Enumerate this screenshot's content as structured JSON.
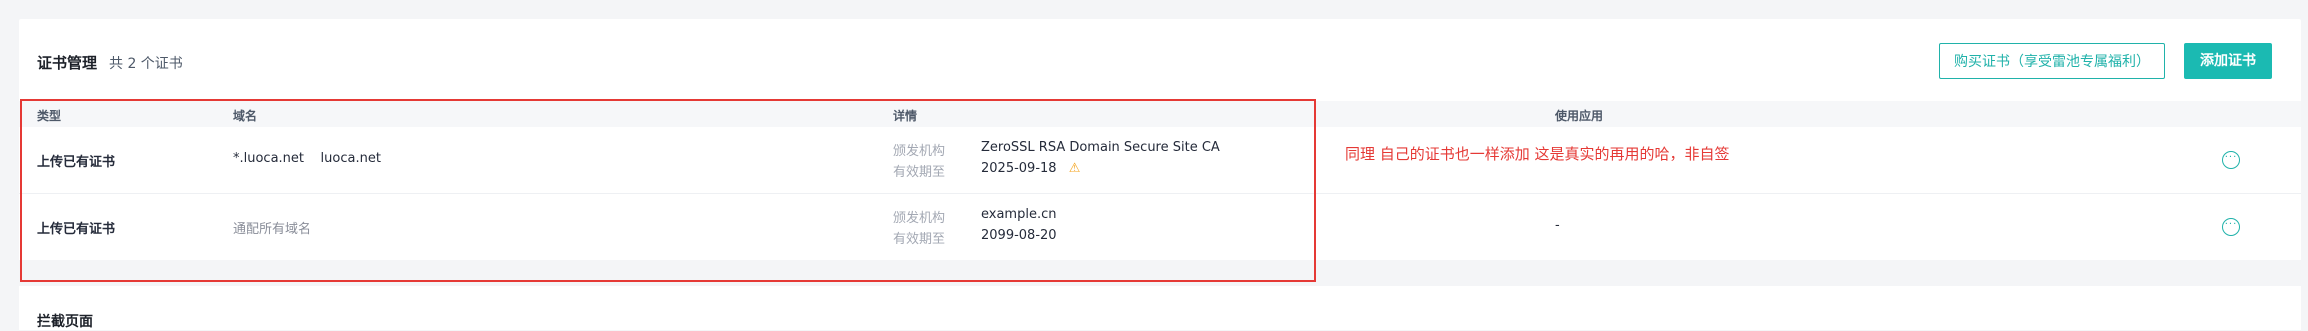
{
  "header": {
    "title": "证书管理",
    "count": "共 2 个证书",
    "buy_button": "购买证书（享受雷池专属福利）",
    "add_button": "添加证书"
  },
  "table": {
    "columns": [
      "类型",
      "域名",
      "详情",
      "使用应用"
    ],
    "rows": [
      {
        "type": "上传已有证书",
        "domains": "*.luoca.net    luoca.net",
        "issuer_label": "颁发机构",
        "issuer": "ZeroSSL RSA Domain Secure Site CA",
        "expiry_label": "有效期至",
        "expiry": "2025-09-18",
        "app": "",
        "warning": "warning-icon"
      },
      {
        "type": "上传已有证书",
        "domains": "通配所有域名",
        "issuer_label": "颁发机构",
        "issuer": "example.cn",
        "expiry_label": "有效期至",
        "expiry": "2099-08-20",
        "app": "-"
      }
    ]
  },
  "annotation": {
    "note": "同理 自己的证书也一样添加  这是真实的再用的哈，非自签",
    "color": "#e53935"
  },
  "next_section": {
    "title": "拦截页面"
  },
  "colors": {
    "accent": "#1bbab2",
    "background": "#f4f5f7"
  }
}
